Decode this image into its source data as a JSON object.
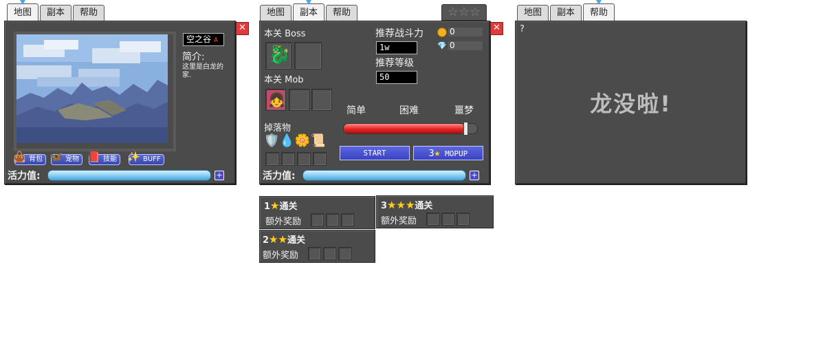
{
  "tabs": {
    "map": "地图",
    "dungeon": "副本",
    "help": "帮助"
  },
  "close_glyph": "✕",
  "map_panel": {
    "location": "空之谷",
    "location_suffix": "A",
    "intro_title": "简介:",
    "intro_text": "这里是白龙的家.",
    "buttons": {
      "bag": "背包",
      "pet": "宠物",
      "skill": "技能",
      "buff": "BUFF"
    },
    "energy_label": "活力值:",
    "plus": "+"
  },
  "dungeon_panel": {
    "stars_glyph": "☆☆☆",
    "boss_label": "本关 Boss",
    "mob_label": "本关 Mob",
    "drop_label": "掉落物",
    "power_label": "推荐战斗力",
    "power_value": "1w",
    "level_label": "推荐等级",
    "level_value": "50",
    "coin_value": "0",
    "gem_value": "0",
    "difficulty": {
      "easy": "简单",
      "hard": "困难",
      "nightmare": "噩梦",
      "level": 1.0
    },
    "start_button": "START",
    "mopup_count": "3",
    "mopup_label": "MOPUP",
    "energy_label": "活力值:",
    "plus": "+"
  },
  "rewards": {
    "one_star": {
      "count": "1",
      "label": "通关",
      "extra": "额外奖励"
    },
    "two_star": {
      "count": "2",
      "label": "通关",
      "extra": "额外奖励"
    },
    "three_star": {
      "count": "3",
      "label": "通关",
      "extra": "额外奖励"
    }
  },
  "help_panel": {
    "question": "?",
    "message": "龙没啦!"
  },
  "colors": {
    "panel": "#4b4b4b",
    "accent": "#4aa8e0",
    "close": "#e03a3a",
    "slider": "#e52222"
  }
}
